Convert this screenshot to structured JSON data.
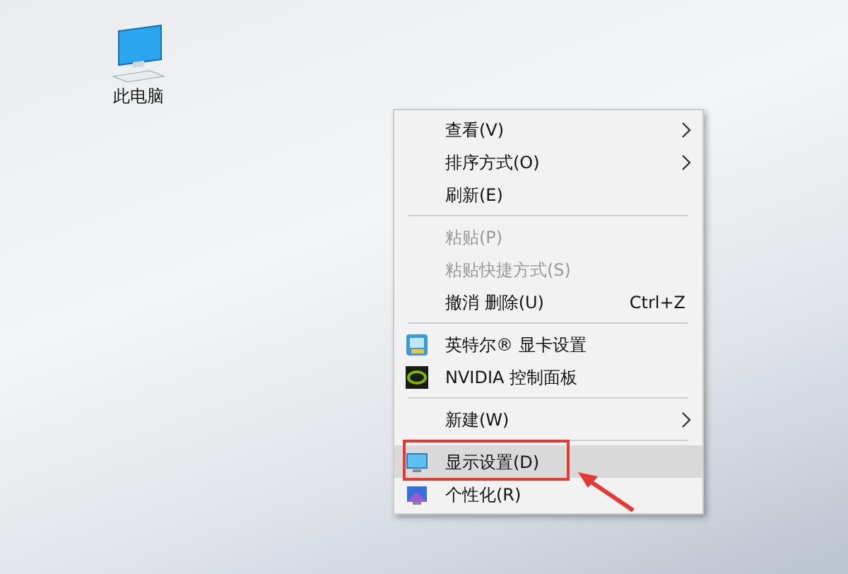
{
  "desktop_icons": [
    {
      "label": "此电脑"
    }
  ],
  "context_menu": {
    "items": [
      {
        "kind": "plain",
        "label": "查看(V)",
        "submenu": true,
        "disabled": false,
        "selected": false
      },
      {
        "kind": "plain",
        "label": "排序方式(O)",
        "submenu": true,
        "disabled": false,
        "selected": false
      },
      {
        "kind": "plain",
        "label": "刷新(E)",
        "submenu": false,
        "disabled": false,
        "selected": false
      },
      {
        "kind": "separator"
      },
      {
        "kind": "plain",
        "label": "粘贴(P)",
        "submenu": false,
        "disabled": true,
        "selected": false
      },
      {
        "kind": "plain",
        "label": "粘贴快捷方式(S)",
        "submenu": false,
        "disabled": true,
        "selected": false
      },
      {
        "kind": "plain",
        "label": "撤消 删除(U)",
        "shortcut": "Ctrl+Z",
        "submenu": false,
        "disabled": false,
        "selected": false
      },
      {
        "kind": "separator"
      },
      {
        "kind": "intel-app",
        "label": "英特尔® 显卡设置",
        "submenu": false,
        "disabled": false,
        "selected": false
      },
      {
        "kind": "nvidia-app",
        "label": "NVIDIA 控制面板",
        "submenu": false,
        "disabled": false,
        "selected": false
      },
      {
        "kind": "separator"
      },
      {
        "kind": "plain",
        "label": "新建(W)",
        "submenu": true,
        "disabled": false,
        "selected": false
      },
      {
        "kind": "separator"
      },
      {
        "kind": "display",
        "label": "显示设置(D)",
        "submenu": false,
        "disabled": false,
        "selected": true,
        "highlighted": true
      },
      {
        "kind": "personalize",
        "label": "个性化(R)",
        "submenu": false,
        "disabled": false,
        "selected": false,
        "highlighted": false
      }
    ]
  }
}
